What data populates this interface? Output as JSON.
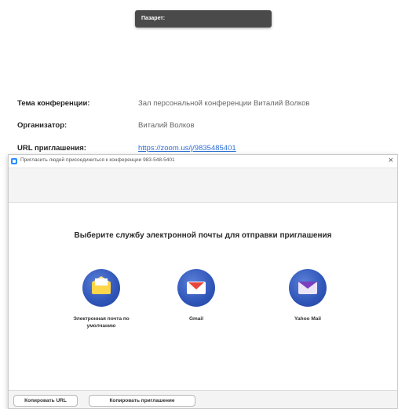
{
  "tooltip": {
    "text": "Пазарет:"
  },
  "meeting_info": {
    "topic_label": "Тема конференции:",
    "topic_value": "Зал персональной конференции Виталий Волков",
    "host_label": "Организатор:",
    "host_value": "Виталий Волков",
    "url_label": "URL приглашения:",
    "url_value": "https://zoom.us/j/9835485401"
  },
  "dialog": {
    "title": "Пригласить людей присоединиться к конференции 983-548-5401",
    "close_glyph": "×",
    "heading": "Выберите службу электронной почты для отправки приглашения",
    "services": [
      {
        "label": "Электронная почта по умолчанию",
        "icon": "default-mail-icon"
      },
      {
        "label": "Gmail",
        "icon": "gmail-icon"
      },
      {
        "label": "Yahoo Mail",
        "icon": "yahoo-mail-icon"
      }
    ],
    "copy_url_label": "Копировать URL",
    "copy_invite_label": "Копировать приглашение"
  },
  "colors": {
    "accent": "#2d8cff",
    "service_circle": "#2f55b8",
    "tooltip_bg": "#4a4a4a"
  }
}
